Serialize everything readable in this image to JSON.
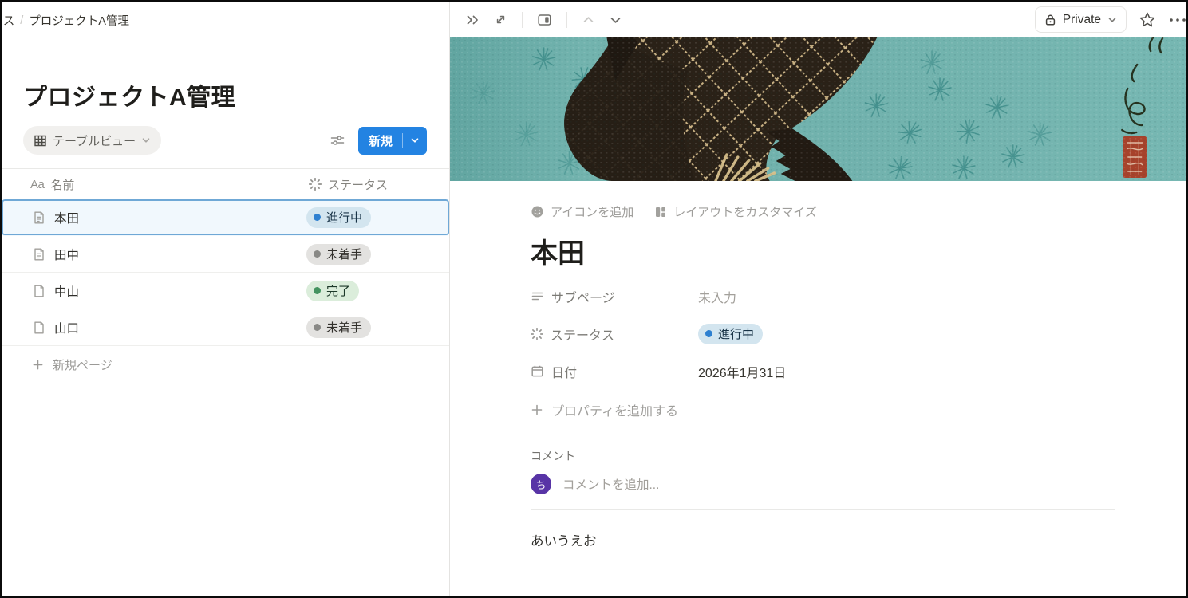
{
  "breadcrumb": {
    "prefix": "ース",
    "separator": "/",
    "current": "プロジェクトA管理"
  },
  "database": {
    "title": "プロジェクトA管理",
    "view_label": "テーブルビュー",
    "new_label": "新規",
    "header": {
      "name_icon_label": "Aa",
      "name": "名前",
      "status": "ステータス"
    },
    "rows": [
      {
        "name": "本田",
        "status": "進行中",
        "tag_bg": "#d3e5ef",
        "tag_dot": "#2e80d0",
        "tag_text": "#183347",
        "selected": true
      },
      {
        "name": "田中",
        "status": "未着手",
        "tag_bg": "#e3e2e0",
        "tag_dot": "#898986",
        "tag_text": "#32302c",
        "selected": false
      },
      {
        "name": "中山",
        "status": "完了",
        "tag_bg": "#dbeddb",
        "tag_dot": "#43935f",
        "tag_text": "#1c3829",
        "selected": false
      },
      {
        "name": "山口",
        "status": "未着手",
        "tag_bg": "#e3e2e0",
        "tag_dot": "#898986",
        "tag_text": "#32302c",
        "selected": false
      }
    ],
    "new_page_label": "新規ページ"
  },
  "peek": {
    "privacy_label": "Private",
    "add_icon_label": "アイコンを追加",
    "customize_layout_label": "レイアウトをカスタマイズ",
    "title": "本田",
    "properties": {
      "subpage": {
        "label": "サブページ",
        "value": "未入力"
      },
      "status": {
        "label": "ステータス",
        "value": "進行中",
        "tag_bg": "#d3e5ef",
        "tag_dot": "#2e80d0",
        "tag_text": "#183347"
      },
      "date": {
        "label": "日付",
        "value": "2026年1月31日"
      }
    },
    "add_property_label": "プロパティを追加する",
    "comments": {
      "heading": "コメント",
      "avatar_initial": "ち",
      "avatar_bg": "#5834a6",
      "placeholder": "コメントを追加..."
    },
    "body_text": "あいうえお"
  },
  "colors": {
    "accent_blue": "#2383e2",
    "selected_row_border": "#6fa8d6",
    "selected_row_bg": "#f1f8fd",
    "cover_teal": "#72b3ae",
    "cover_fish_dark": "#261e15",
    "cover_scale_cream": "#c9b183",
    "cover_seal_red": "#a7422b"
  }
}
